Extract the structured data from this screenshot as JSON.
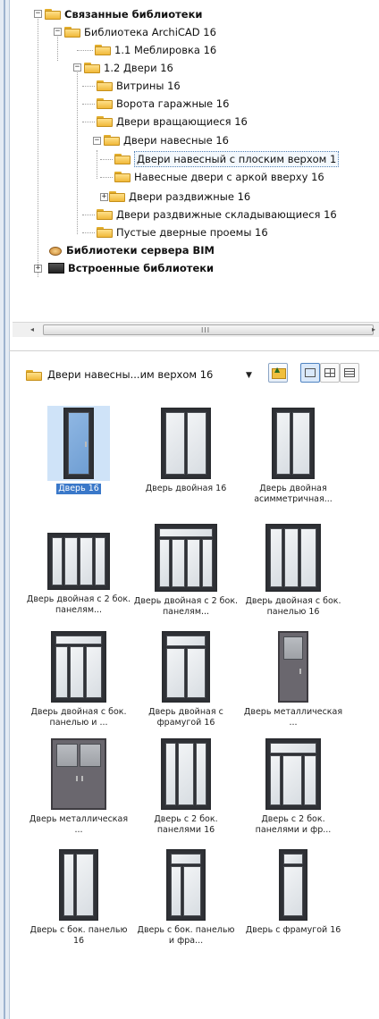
{
  "tree": {
    "linked_libraries": "Связанные библиотеки",
    "archicad_library": "Библиотека ArchiCAD 16",
    "furniture": "1.1 Меблировка 16",
    "doors": "1.2 Двери 16",
    "shop_windows": "Витрины 16",
    "garage_gates": "Ворота гаражные 16",
    "revolving_doors": "Двери вращающиеся 16",
    "hinged_doors": "Двери навесные 16",
    "hinged_flat_top": "Двери навесный с плоским верхом 1",
    "hinged_arched_top": "Навесные двери с аркой вверху 16",
    "sliding_doors": "Двери раздвижные 16",
    "folding_sliding_doors": "Двери раздвижные складывающиеся 16",
    "empty_openings": "Пустые дверные проемы 16",
    "bim_server_libraries": "Библиотеки сервера BIM",
    "embedded_libraries": "Встроенные библиотеки"
  },
  "scrollbar": {
    "grip": "III",
    "left_arrow": "◂",
    "right_arrow": "▸"
  },
  "toolbar": {
    "folder_combo": "Двери навесны...им верхом 16",
    "dropdown_arrow": "▼"
  },
  "items": [
    "Дверь 16",
    "Дверь двойная 16",
    "Дверь двойная асимметричная...",
    "Дверь двойная с 2 бок. панелям...",
    "Дверь двойная с 2 бок. панелям...",
    "Дверь двойная с бок. панелью 16",
    "Дверь двойная с бок. панелью и ...",
    "Дверь двойная с фрамугой 16",
    "Дверь металлическая ...",
    "Дверь металлическая ...",
    "Дверь с 2 бок. панелями 16",
    "Дверь с 2 бок. панелями и фр...",
    "Дверь с бок. панелью 16",
    "Дверь с бок. панелью и фра...",
    "Дверь с фрамугой 16"
  ]
}
